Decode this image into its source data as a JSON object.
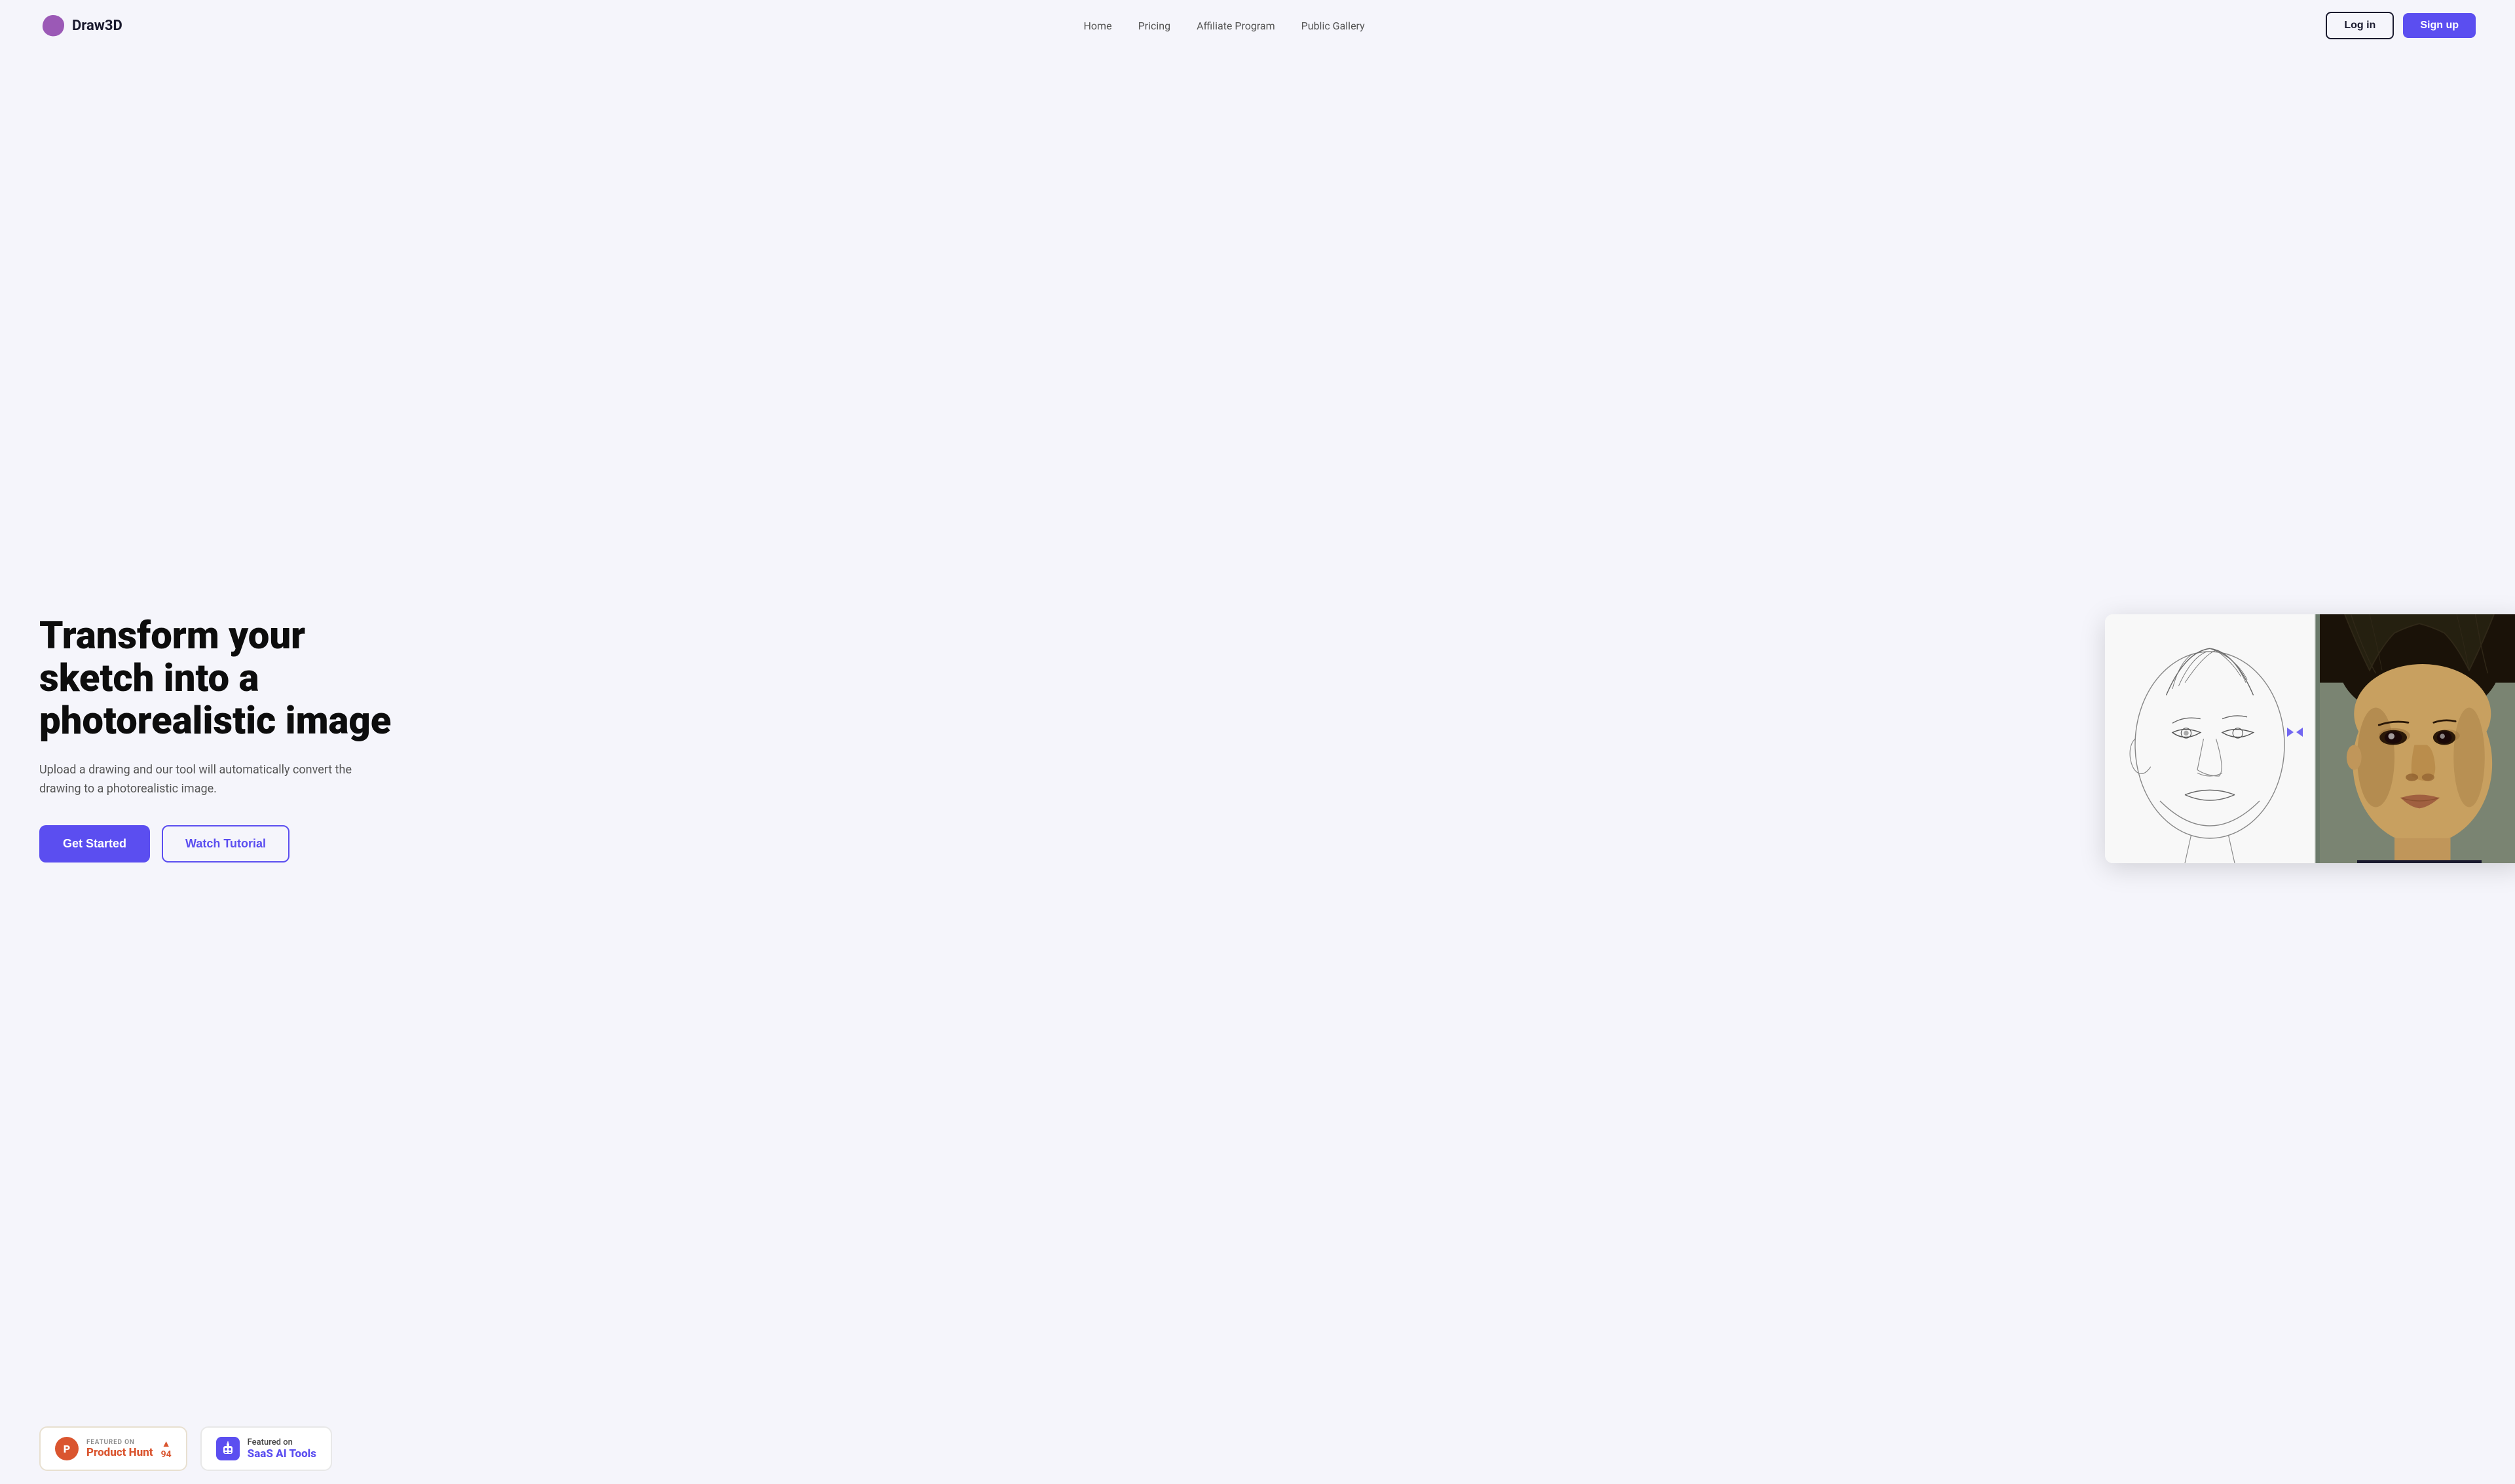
{
  "brand": {
    "logo_text": "Draw3D",
    "logo_icon": "blob-purple-icon"
  },
  "nav": {
    "links": [
      {
        "label": "Home",
        "id": "home"
      },
      {
        "label": "Pricing",
        "id": "pricing"
      },
      {
        "label": "Affiliate Program",
        "id": "affiliate"
      },
      {
        "label": "Public Gallery",
        "id": "gallery"
      }
    ],
    "login_label": "Log in",
    "signup_label": "Sign up"
  },
  "hero": {
    "title_line1": "Transform your",
    "title_line2": "sketch into a",
    "title_line3": "photorealistic image",
    "subtitle": "Upload a drawing and our tool will automatically convert the drawing to a photorealistic image.",
    "cta_primary": "Get Started",
    "cta_secondary": "Watch Tutorial"
  },
  "badges": {
    "producthunt": {
      "featured_label": "FEATURED ON",
      "name": "Product Hunt",
      "score": "94",
      "arrow": "▲"
    },
    "saas": {
      "featured_label": "Featured on",
      "name_plain": "SaaS",
      "name_colored": "AI Tools"
    }
  },
  "colors": {
    "brand_purple": "#5b4ef0",
    "text_dark": "#0d0d0d",
    "text_muted": "#555555",
    "bg_light": "#f5f5fb",
    "producthunt_red": "#da552f"
  }
}
